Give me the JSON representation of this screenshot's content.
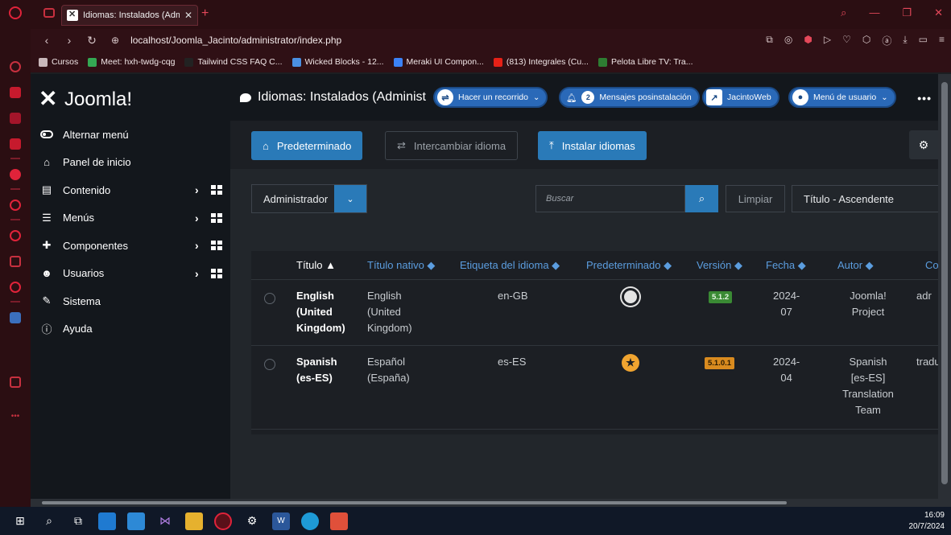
{
  "browser": {
    "tab_title": "Idiomas: Instalados (Admin",
    "tab_close": "✕",
    "tab_add": "+",
    "url": "localhost/Joomla_Jacinto/administrator/index.php",
    "bookmarks": [
      {
        "label": "Cursos",
        "icon": "folder-icon",
        "color": "#c8b8ba"
      },
      {
        "label": "Meet: hxh-twdg-cqg",
        "icon": "meet-icon",
        "color": "#34a853"
      },
      {
        "label": "Tailwind CSS FAQ C...",
        "icon": "ui-icon",
        "color": "#222222"
      },
      {
        "label": "Wicked Blocks - 12...",
        "icon": "blocks-icon",
        "color": "#4a90e2"
      },
      {
        "label": "Meraki UI Compon...",
        "icon": "meraki-icon",
        "color": "#3b82f6"
      },
      {
        "label": "(813) Integrales (Cu...",
        "icon": "youtube-icon",
        "color": "#e62117"
      },
      {
        "label": "Pelota Libre TV: Tra...",
        "icon": "pelota-icon",
        "color": "#2e7d32"
      }
    ]
  },
  "joomla": {
    "logo_text": "Joomla!",
    "page_title": "Idiomas: Instalados (Administ",
    "header_buttons": {
      "tour": "Hacer un recorrido",
      "messages_count": "2",
      "messages": "Mensajes posinstalación",
      "site": "JacintoWeb",
      "user_menu": "Menú de usuario"
    },
    "more": "•••"
  },
  "sidebar": {
    "items": [
      {
        "label": "Alternar menú",
        "icon": "toggle-icon",
        "submenu": false
      },
      {
        "label": "Panel de inicio",
        "icon": "home-icon",
        "submenu": false
      },
      {
        "label": "Contenido",
        "icon": "file-icon",
        "submenu": true
      },
      {
        "label": "Menús",
        "icon": "list-icon",
        "submenu": true
      },
      {
        "label": "Componentes",
        "icon": "puzzle-icon",
        "submenu": true
      },
      {
        "label": "Usuarios",
        "icon": "users-icon",
        "submenu": true
      },
      {
        "label": "Sistema",
        "icon": "wrench-icon",
        "submenu": false
      },
      {
        "label": "Ayuda",
        "icon": "info-icon",
        "submenu": false
      }
    ]
  },
  "toolbar": {
    "default_label": "Predeterminado",
    "switch_label": "Intercambiar idioma",
    "install_label": "Instalar idiomas"
  },
  "filters": {
    "client_value": "Administrador",
    "search_placeholder": "Buscar",
    "clear_label": "Limpiar",
    "sort_value": "Título - Ascendente"
  },
  "table": {
    "headers": {
      "title": "Título ▲",
      "native_title": "Título nativo ◆",
      "tag": "Etiqueta del idioma ◆",
      "default": "Predeterminado ◆",
      "version": "Versión ◆",
      "date": "Fecha ◆",
      "author": "Autor ◆",
      "contact": "Co"
    },
    "rows": [
      {
        "title_lines": [
          "English",
          "(United",
          "Kingdom)"
        ],
        "native_lines": [
          "English",
          "(United",
          "Kingdom)"
        ],
        "tag": "en-GB",
        "default": "active",
        "version": "5.1.2",
        "version_color": "#3a8a34",
        "date_lines": [
          "2024-",
          "07"
        ],
        "author_lines": [
          "Joomla!",
          "Project"
        ],
        "contact": "adr"
      },
      {
        "title_lines": [
          "Spanish",
          "(es-ES)"
        ],
        "native_lines": [
          "Español",
          "(España)"
        ],
        "tag": "es-ES",
        "default": "star",
        "version": "5.1.0.1",
        "version_color": "#d98b1f",
        "date_lines": [
          "2024-",
          "04"
        ],
        "author_lines": [
          "Spanish",
          "[es-ES]",
          "Translation",
          "Team"
        ],
        "contact": "traduc"
      }
    ]
  },
  "taskbar": {
    "time": "16:09",
    "date": "20/7/2024"
  }
}
